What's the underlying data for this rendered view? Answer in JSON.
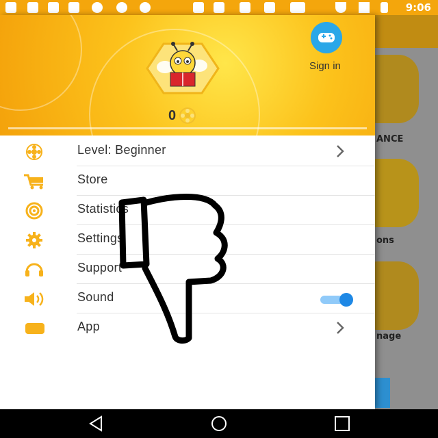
{
  "status_bar": {
    "time": "9:06",
    "icons": [
      "chat-icon",
      "facebook-icon",
      "gmail-icon",
      "facebook-icon",
      "stat-icon",
      "stat-icon",
      "stat-icon",
      "sd-card-icon",
      "mascot-icon",
      "linkedin-icon",
      "mascot-icon",
      "esc-icon",
      "wifi-icon",
      "signal-icon",
      "battery-icon"
    ]
  },
  "drawer": {
    "header": {
      "sign_in_label": "Sign in",
      "coins": "0"
    },
    "menu": [
      {
        "label": "Level: Beginner",
        "icon": "flower-icon",
        "has_chevron": true
      },
      {
        "label": "Store",
        "icon": "cart-icon"
      },
      {
        "label": "Statistics",
        "icon": "target-icon"
      },
      {
        "label": "Settings",
        "icon": "gear-icon"
      },
      {
        "label": "Support",
        "icon": "headset-icon"
      },
      {
        "label": "Sound",
        "icon": "speaker-icon",
        "toggle": true
      },
      {
        "label": "App",
        "icon": "app-icon",
        "has_chevron": true
      }
    ]
  },
  "background_app": {
    "labels": [
      "ANCE",
      "ons",
      "nage"
    ]
  },
  "colors": {
    "accent": "#f5a623",
    "icon": "#f7b21b",
    "toggle": "#1e88e5"
  }
}
